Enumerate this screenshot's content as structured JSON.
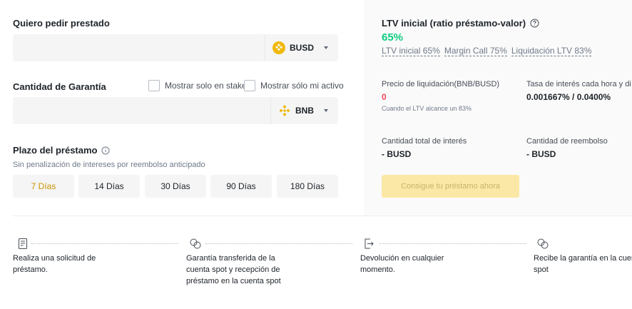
{
  "borrow": {
    "label": "Quiero pedir prestado",
    "coin": "BUSD",
    "icon": "busd-icon"
  },
  "collateral": {
    "label": "Cantidad de Garantía",
    "checkbox_stake": "Mostrar solo en stake",
    "checkbox_assets": "Mostrar sólo mi activo",
    "coin": "BNB",
    "icon": "bnb-icon"
  },
  "term": {
    "label": "Plazo del préstamo",
    "note": "Sin penalización de intereses por reembolso anticipado",
    "options": [
      "7 Días",
      "14 Días",
      "30 Días",
      "90 Días",
      "180 Días"
    ],
    "selected": "7 Días"
  },
  "summary": {
    "ltv_title": "LTV inicial (ratio préstamo-valor)",
    "ltv_value": "65%",
    "ltv_initial": "LTV inicial 65%",
    "margin_call": "Margin Call 75%",
    "liquidation": "Liquidación LTV 83%",
    "liq_price_label": "Precio de liquidación(BNB/BUSD)",
    "liq_price_value": "0",
    "liq_price_note": "Cuando el LTV alcance un 83%",
    "rate_label": "Tasa de interés cada hora y di",
    "rate_value": "0.001667% / 0.0400%",
    "total_interest_label": "Cantidad total de interés",
    "total_interest_value": "- BUSD",
    "repay_label": "Cantidad de reembolso",
    "repay_value": "- BUSD",
    "cta": "Consigue tu préstamo ahora"
  },
  "steps": [
    {
      "icon": "document-icon",
      "line1": "Realiza una solicitud de",
      "line2": "préstamo.",
      "line3": ""
    },
    {
      "icon": "transfer-icon",
      "line1": "Garantía transferida de la",
      "line2": "cuenta spot y recepción de",
      "line3": "préstamo en la cuenta spot"
    },
    {
      "icon": "return-icon",
      "line1": "Devolución en cualquier",
      "line2": "momento.",
      "line3": ""
    },
    {
      "icon": "transfer-icon",
      "line1": "Recibe la garantía en la cuen",
      "line2": "spot",
      "line3": ""
    }
  ],
  "colors": {
    "accent": "#f0b90b",
    "selected_text": "#c99400",
    "ltv_green": "#0ecb81",
    "liq_red": "#f6465d",
    "cta_bg": "#fbe8a6"
  }
}
